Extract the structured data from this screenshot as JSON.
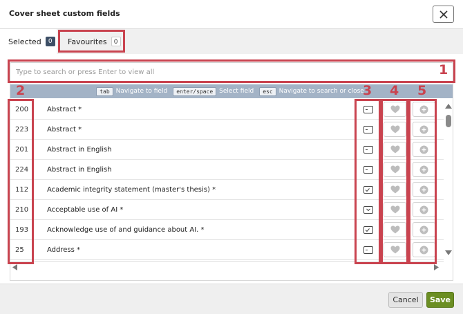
{
  "dialog": {
    "title": "Cover sheet custom fields",
    "close_icon": "close-icon"
  },
  "tabs": [
    {
      "label": "Selected",
      "count": "0",
      "active": true
    },
    {
      "label": "Favourites",
      "count": "0",
      "active": false
    }
  ],
  "search": {
    "placeholder": "Type to search or press Enter to view all",
    "value": ""
  },
  "hints": [
    {
      "key": "tab",
      "text": "Navigate to field"
    },
    {
      "key": "enter/space",
      "text": "Select field"
    },
    {
      "key": "esc",
      "text": "Navigate to search or close"
    }
  ],
  "fields": [
    {
      "id": "200",
      "name": "Abstract *",
      "type_icon": "text-field-icon"
    },
    {
      "id": "223",
      "name": "Abstract *",
      "type_icon": "text-field-icon"
    },
    {
      "id": "201",
      "name": "Abstract in English",
      "type_icon": "text-field-icon"
    },
    {
      "id": "224",
      "name": "Abstract in English",
      "type_icon": "text-field-icon"
    },
    {
      "id": "112",
      "name": "Academic integrity statement (master's thesis) *",
      "type_icon": "checkbox-field-icon"
    },
    {
      "id": "210",
      "name": "Acceptable use of AI *",
      "type_icon": "dropdown-field-icon"
    },
    {
      "id": "193",
      "name": "Acknowledge use of and guidance about AI. *",
      "type_icon": "checkbox-field-icon"
    },
    {
      "id": "25",
      "name": "Address *",
      "type_icon": "text-field-icon"
    }
  ],
  "row_actions": {
    "favourite_icon": "heart-icon",
    "add_icon": "plus-circle-icon"
  },
  "footer": {
    "cancel_label": "Cancel",
    "save_label": "Save",
    "save_color": "#6b8e23"
  },
  "annotations": {
    "color": "#c9434f",
    "labels": [
      "1",
      "2",
      "3",
      "4",
      "5"
    ]
  }
}
